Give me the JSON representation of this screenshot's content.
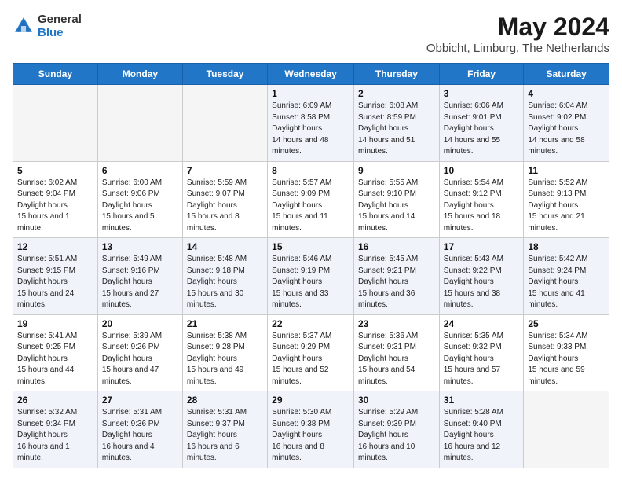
{
  "header": {
    "logo_line1": "General",
    "logo_line2": "Blue",
    "title": "May 2024",
    "subtitle": "Obbicht, Limburg, The Netherlands"
  },
  "days_of_week": [
    "Sunday",
    "Monday",
    "Tuesday",
    "Wednesday",
    "Thursday",
    "Friday",
    "Saturday"
  ],
  "weeks": [
    [
      {
        "day": null,
        "sunrise": null,
        "sunset": null,
        "daylight": null
      },
      {
        "day": null,
        "sunrise": null,
        "sunset": null,
        "daylight": null
      },
      {
        "day": null,
        "sunrise": null,
        "sunset": null,
        "daylight": null
      },
      {
        "day": "1",
        "sunrise": "6:09 AM",
        "sunset": "8:58 PM",
        "daylight": "14 hours and 48 minutes."
      },
      {
        "day": "2",
        "sunrise": "6:08 AM",
        "sunset": "8:59 PM",
        "daylight": "14 hours and 51 minutes."
      },
      {
        "day": "3",
        "sunrise": "6:06 AM",
        "sunset": "9:01 PM",
        "daylight": "14 hours and 55 minutes."
      },
      {
        "day": "4",
        "sunrise": "6:04 AM",
        "sunset": "9:02 PM",
        "daylight": "14 hours and 58 minutes."
      }
    ],
    [
      {
        "day": "5",
        "sunrise": "6:02 AM",
        "sunset": "9:04 PM",
        "daylight": "15 hours and 1 minute."
      },
      {
        "day": "6",
        "sunrise": "6:00 AM",
        "sunset": "9:06 PM",
        "daylight": "15 hours and 5 minutes."
      },
      {
        "day": "7",
        "sunrise": "5:59 AM",
        "sunset": "9:07 PM",
        "daylight": "15 hours and 8 minutes."
      },
      {
        "day": "8",
        "sunrise": "5:57 AM",
        "sunset": "9:09 PM",
        "daylight": "15 hours and 11 minutes."
      },
      {
        "day": "9",
        "sunrise": "5:55 AM",
        "sunset": "9:10 PM",
        "daylight": "15 hours and 14 minutes."
      },
      {
        "day": "10",
        "sunrise": "5:54 AM",
        "sunset": "9:12 PM",
        "daylight": "15 hours and 18 minutes."
      },
      {
        "day": "11",
        "sunrise": "5:52 AM",
        "sunset": "9:13 PM",
        "daylight": "15 hours and 21 minutes."
      }
    ],
    [
      {
        "day": "12",
        "sunrise": "5:51 AM",
        "sunset": "9:15 PM",
        "daylight": "15 hours and 24 minutes."
      },
      {
        "day": "13",
        "sunrise": "5:49 AM",
        "sunset": "9:16 PM",
        "daylight": "15 hours and 27 minutes."
      },
      {
        "day": "14",
        "sunrise": "5:48 AM",
        "sunset": "9:18 PM",
        "daylight": "15 hours and 30 minutes."
      },
      {
        "day": "15",
        "sunrise": "5:46 AM",
        "sunset": "9:19 PM",
        "daylight": "15 hours and 33 minutes."
      },
      {
        "day": "16",
        "sunrise": "5:45 AM",
        "sunset": "9:21 PM",
        "daylight": "15 hours and 36 minutes."
      },
      {
        "day": "17",
        "sunrise": "5:43 AM",
        "sunset": "9:22 PM",
        "daylight": "15 hours and 38 minutes."
      },
      {
        "day": "18",
        "sunrise": "5:42 AM",
        "sunset": "9:24 PM",
        "daylight": "15 hours and 41 minutes."
      }
    ],
    [
      {
        "day": "19",
        "sunrise": "5:41 AM",
        "sunset": "9:25 PM",
        "daylight": "15 hours and 44 minutes."
      },
      {
        "day": "20",
        "sunrise": "5:39 AM",
        "sunset": "9:26 PM",
        "daylight": "15 hours and 47 minutes."
      },
      {
        "day": "21",
        "sunrise": "5:38 AM",
        "sunset": "9:28 PM",
        "daylight": "15 hours and 49 minutes."
      },
      {
        "day": "22",
        "sunrise": "5:37 AM",
        "sunset": "9:29 PM",
        "daylight": "15 hours and 52 minutes."
      },
      {
        "day": "23",
        "sunrise": "5:36 AM",
        "sunset": "9:31 PM",
        "daylight": "15 hours and 54 minutes."
      },
      {
        "day": "24",
        "sunrise": "5:35 AM",
        "sunset": "9:32 PM",
        "daylight": "15 hours and 57 minutes."
      },
      {
        "day": "25",
        "sunrise": "5:34 AM",
        "sunset": "9:33 PM",
        "daylight": "15 hours and 59 minutes."
      }
    ],
    [
      {
        "day": "26",
        "sunrise": "5:32 AM",
        "sunset": "9:34 PM",
        "daylight": "16 hours and 1 minute."
      },
      {
        "day": "27",
        "sunrise": "5:31 AM",
        "sunset": "9:36 PM",
        "daylight": "16 hours and 4 minutes."
      },
      {
        "day": "28",
        "sunrise": "5:31 AM",
        "sunset": "9:37 PM",
        "daylight": "16 hours and 6 minutes."
      },
      {
        "day": "29",
        "sunrise": "5:30 AM",
        "sunset": "9:38 PM",
        "daylight": "16 hours and 8 minutes."
      },
      {
        "day": "30",
        "sunrise": "5:29 AM",
        "sunset": "9:39 PM",
        "daylight": "16 hours and 10 minutes."
      },
      {
        "day": "31",
        "sunrise": "5:28 AM",
        "sunset": "9:40 PM",
        "daylight": "16 hours and 12 minutes."
      },
      {
        "day": null,
        "sunrise": null,
        "sunset": null,
        "daylight": null
      }
    ]
  ]
}
